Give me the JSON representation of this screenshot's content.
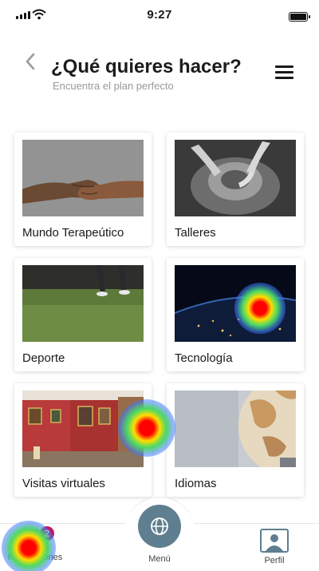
{
  "status": {
    "time": "9:27"
  },
  "header": {
    "title": "¿Qué quieres hacer?",
    "subtitle": "Encuentra el plan perfecto"
  },
  "cards": [
    {
      "label": "Mundo Terapeútico",
      "image": "handshake-photo"
    },
    {
      "label": "Talleres",
      "image": "pottery-photo"
    },
    {
      "label": "Deporte",
      "image": "grass-running-photo"
    },
    {
      "label": "Tecnología",
      "image": "earth-night-photo"
    },
    {
      "label": "Visitas virtuales",
      "image": "museum-gallery-photo"
    },
    {
      "label": "Idiomas",
      "image": "globe-photo"
    }
  ],
  "bottom_nav": {
    "notifications": {
      "label": "Notificaciones",
      "badge": "2"
    },
    "menu": {
      "label": "Menú"
    },
    "profile": {
      "label": "Perfil"
    }
  },
  "colors": {
    "accent": "#5f7e8f",
    "badge": "#c2185b"
  }
}
